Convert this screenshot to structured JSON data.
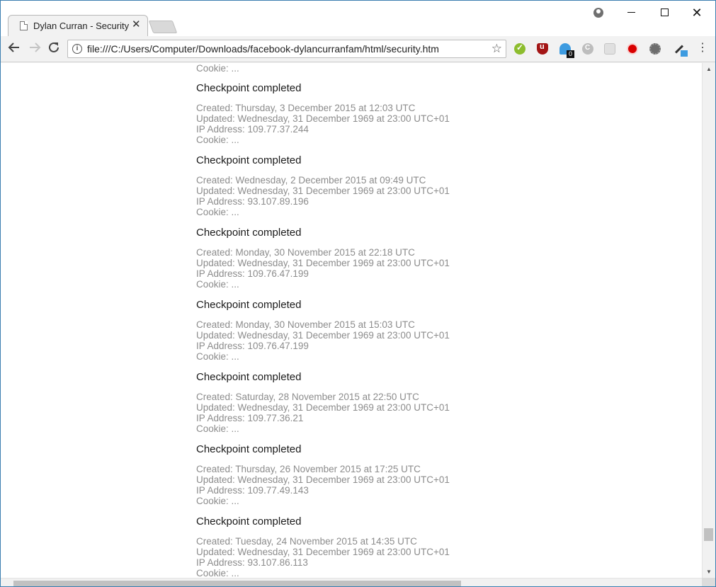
{
  "browser": {
    "tab_title": "Dylan Curran - Security",
    "tab_close": "✕",
    "url": "file:///C:/Users/Computer/Downloads/facebook-dylancurranfam/html/security.htm",
    "extension_badge": "0",
    "window_close": "✕",
    "menu": "⋮"
  },
  "page": {
    "partial_cookie": "Cookie: ...",
    "entries": [
      {
        "title": "Checkpoint completed",
        "created": "Created: Thursday, 3 December 2015 at 12:03 UTC",
        "updated": "Updated: Wednesday, 31 December 1969 at 23:00 UTC+01",
        "ip": "IP Address: 109.77.37.244",
        "cookie": "Cookie: ..."
      },
      {
        "title": "Checkpoint completed",
        "created": "Created: Wednesday, 2 December 2015 at 09:49 UTC",
        "updated": "Updated: Wednesday, 31 December 1969 at 23:00 UTC+01",
        "ip": "IP Address: 93.107.89.196",
        "cookie": "Cookie: ..."
      },
      {
        "title": "Checkpoint completed",
        "created": "Created: Monday, 30 November 2015 at 22:18 UTC",
        "updated": "Updated: Wednesday, 31 December 1969 at 23:00 UTC+01",
        "ip": "IP Address: 109.76.47.199",
        "cookie": "Cookie: ..."
      },
      {
        "title": "Checkpoint completed",
        "created": "Created: Monday, 30 November 2015 at 15:03 UTC",
        "updated": "Updated: Wednesday, 31 December 1969 at 23:00 UTC+01",
        "ip": "IP Address: 109.76.47.199",
        "cookie": "Cookie: ..."
      },
      {
        "title": "Checkpoint completed",
        "created": "Created: Saturday, 28 November 2015 at 22:50 UTC",
        "updated": "Updated: Wednesday, 31 December 1969 at 23:00 UTC+01",
        "ip": "IP Address: 109.77.36.21",
        "cookie": "Cookie: ..."
      },
      {
        "title": "Checkpoint completed",
        "created": "Created: Thursday, 26 November 2015 at 17:25 UTC",
        "updated": "Updated: Wednesday, 31 December 1969 at 23:00 UTC+01",
        "ip": "IP Address: 109.77.49.143",
        "cookie": "Cookie: ..."
      },
      {
        "title": "Checkpoint completed",
        "created": "Created: Tuesday, 24 November 2015 at 14:35 UTC",
        "updated": "Updated: Wednesday, 31 December 1969 at 23:00 UTC+01",
        "ip": "IP Address: 93.107.86.113",
        "cookie": "Cookie: ..."
      }
    ]
  }
}
